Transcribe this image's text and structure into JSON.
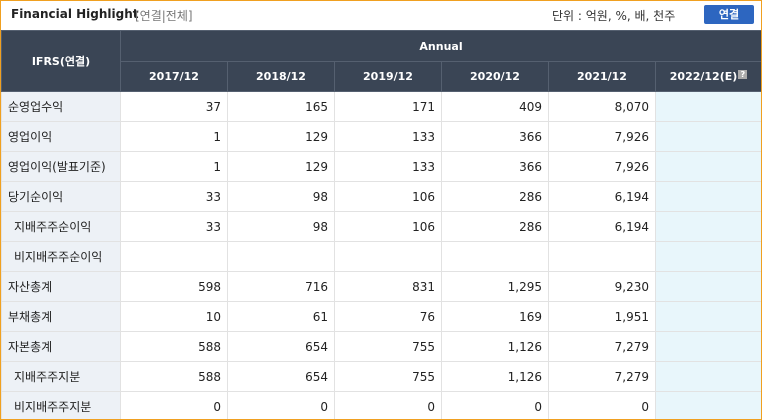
{
  "header": {
    "title": "Financial Highlight",
    "subtitle": "[연결|전체]",
    "unit_text": "단위 : 억원, %, 배, 천주",
    "button_label": "연결"
  },
  "table": {
    "corner_label": "IFRS(연결)",
    "group_label": "Annual",
    "years": [
      "2017/12",
      "2018/12",
      "2019/12",
      "2020/12",
      "2021/12",
      "2022/12(E)"
    ],
    "help_icon": "?",
    "rows": [
      {
        "label": "순영업수익",
        "values": [
          "37",
          "165",
          "171",
          "409",
          "8,070",
          ""
        ]
      },
      {
        "label": "영업이익",
        "values": [
          "1",
          "129",
          "133",
          "366",
          "7,926",
          ""
        ]
      },
      {
        "label": "영업이익(발표기준)",
        "values": [
          "1",
          "129",
          "133",
          "366",
          "7,926",
          ""
        ]
      },
      {
        "label": "당기순이익",
        "values": [
          "33",
          "98",
          "106",
          "286",
          "6,194",
          ""
        ]
      },
      {
        "label": "지배주주순이익",
        "values": [
          "33",
          "98",
          "106",
          "286",
          "6,194",
          ""
        ]
      },
      {
        "label": "비지배주주순이익",
        "values": [
          "",
          "",
          "",
          "",
          "",
          ""
        ]
      },
      {
        "label": "자산총계",
        "values": [
          "598",
          "716",
          "831",
          "1,295",
          "9,230",
          ""
        ]
      },
      {
        "label": "부채총계",
        "values": [
          "10",
          "61",
          "76",
          "169",
          "1,951",
          ""
        ]
      },
      {
        "label": "자본총계",
        "values": [
          "588",
          "654",
          "755",
          "1,126",
          "7,279",
          ""
        ]
      },
      {
        "label": "지배주주지분",
        "values": [
          "588",
          "654",
          "755",
          "1,126",
          "7,279",
          ""
        ]
      },
      {
        "label": "비지배주주지분",
        "values": [
          "0",
          "0",
          "0",
          "0",
          "0",
          ""
        ]
      }
    ]
  }
}
